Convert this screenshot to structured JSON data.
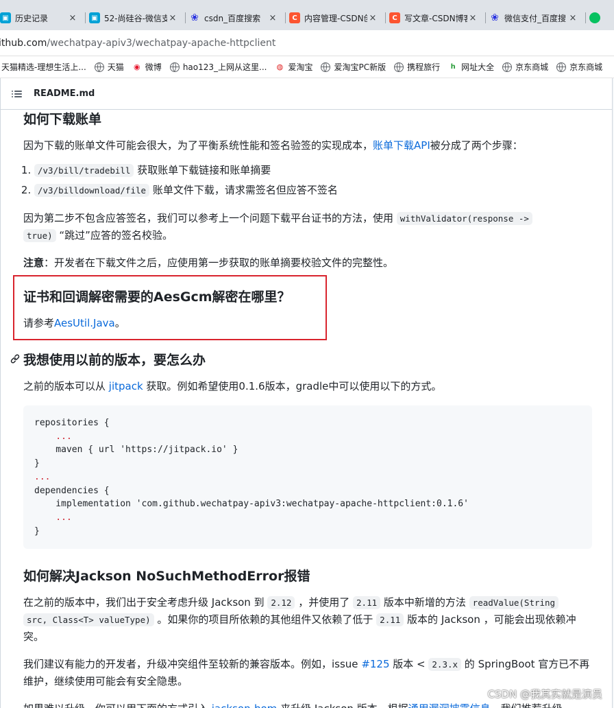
{
  "browser": {
    "tabs": [
      {
        "icon": "bilibili-icon",
        "title": "历史记录"
      },
      {
        "icon": "bilibili-icon",
        "title": "52-尚硅谷-微信支"
      },
      {
        "icon": "baidu-paw-icon",
        "title": "csdn_百度搜索"
      },
      {
        "icon": "csdn-icon",
        "title": "内容管理-CSDN创"
      },
      {
        "icon": "csdn-icon",
        "title": "写文章-CSDN博客"
      },
      {
        "icon": "baidu-paw-icon",
        "title": "微信支付_百度搜"
      }
    ],
    "tab_close_glyph": "×",
    "address": {
      "host": "ithub.com",
      "path": "/wechatpay-apiv3/wechatpay-apache-httpclient"
    },
    "bookmarks": [
      "天猫精选-理想生活上...",
      "天猫",
      "微博",
      "hao123_上网从这里...",
      "爱淘宝",
      "爱淘宝PC新版",
      "携程旅行",
      "网址大全",
      "京东商城",
      "京东商城"
    ]
  },
  "readme": {
    "filename": "README.md",
    "sections": {
      "bill": {
        "heading": "如何下载账单",
        "intro_prefix": "因为下载的账单文件可能会很大，为了平衡系统性能和签名验签的实现成本，",
        "intro_link": "账单下载API",
        "intro_suffix": "被分成了两个步骤：",
        "steps": [
          {
            "code": "/v3/bill/tradebill",
            "text": " 获取账单下载链接和账单摘要"
          },
          {
            "code": "/v3/billdownload/file",
            "text": " 账单文件下载，请求需签名但应答不签名"
          }
        ],
        "para2_prefix": "因为第二步不包含应答签名，我们可以参考上一个问题下载平台证书的方法，使用 ",
        "para2_code1": "withValidator(response ->",
        "para2_code2": "true)",
        "para2_suffix": " “跳过”应答的签名校验。",
        "note_label": "注意",
        "note_text": "：开发者在下载文件之后，应使用第一步获取的账单摘要校验文件的完整性。"
      },
      "aes": {
        "heading": "证书和回调解密需要的AesGcm解密在哪里？",
        "text_prefix": "请参考",
        "link": "AesUtil.Java",
        "text_suffix": "。"
      },
      "version": {
        "heading": "我想使用以前的版本，要怎么办",
        "text_prefix": "之前的版本可以从 ",
        "link": "jitpack",
        "text_suffix": " 获取。例如希望使用0.1.6版本，gradle中可以使用以下的方式。",
        "code_lines": [
          "repositories {",
          "    ...",
          "    maven { url 'https://jitpack.io' }",
          "}",
          "...",
          "dependencies {",
          "    implementation 'com.github.wechatpay-apiv3:wechatpay-apache-httpclient:0.1.6'",
          "    ...",
          "}"
        ]
      },
      "jackson": {
        "heading": "如何解决Jackson NoSuchMethodError报错",
        "p1_a": "在之前的版本中，我们出于安全考虑升级 Jackson 到 ",
        "p1_code1": "2.12",
        "p1_b": " ，并使用了 ",
        "p1_code2": "2.11",
        "p1_c": " 版本中新增的方法 ",
        "p1_code3": "readValue(String",
        "p1_code4": "src, Class<T> valueType)",
        "p1_d": " 。如果你的项目所依赖的其他组件又依赖了低于 ",
        "p1_code5": "2.11",
        "p1_e": " 版本的 Jackson ，可能会出现依赖冲突。",
        "p2_a": "我们建议有能力的开发者，升级冲突组件至较新的兼容版本。例如，issue ",
        "p2_link": "#125",
        "p2_b": " 版本 < ",
        "p2_code": "2.3.x",
        "p2_c": " 的 SpringBoot 官方已不再维护，继续使用可能会有安全隐患。",
        "p3_a": "如果难以升级，你可以用下面的方式引入 ",
        "p3_link1": "jackson-bom",
        "p3_b": " 来升级 Jackson 版本，根据",
        "p3_link2": "通用漏洞披露信息",
        "p3_c": "，我们推荐升级"
      }
    }
  },
  "watermark": "CSDN @我其实就是演员",
  "colors": {
    "link": "#0969da",
    "highlight_border": "#d9232d",
    "code_bg": "#f6f8fa"
  }
}
